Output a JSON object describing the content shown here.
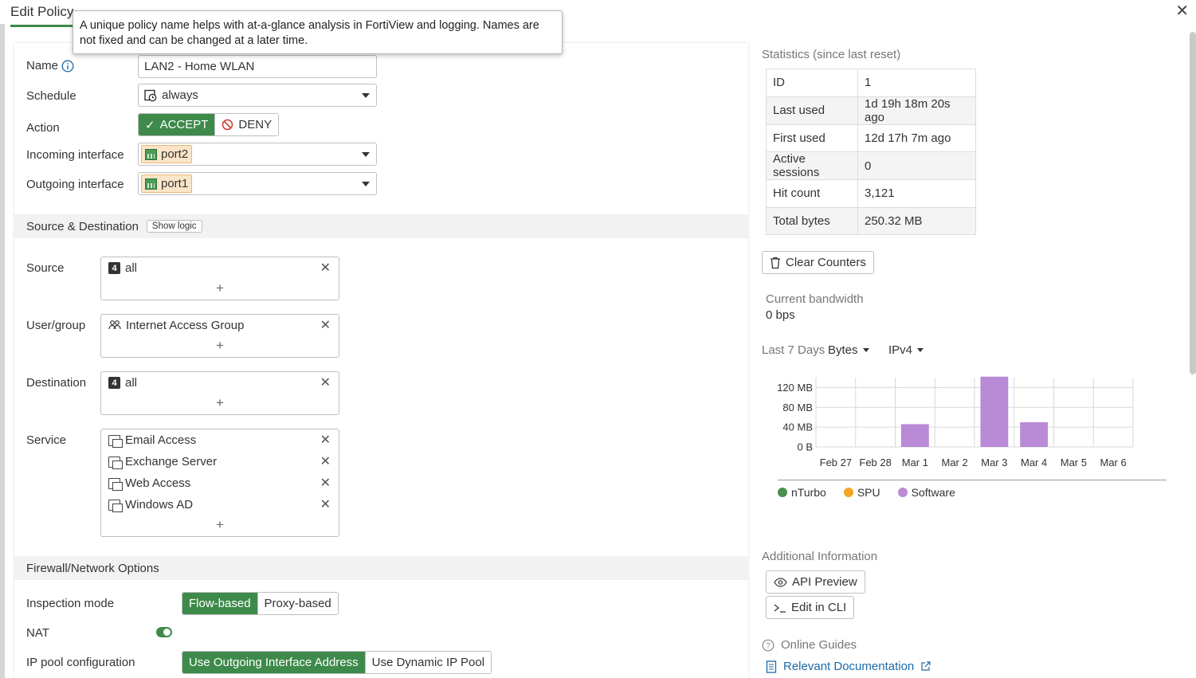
{
  "header": {
    "title": "Edit Policy"
  },
  "tooltip": {
    "text": "A unique policy name helps with at-a-glance analysis in FortiView and logging. Names are not fixed and can be changed at a later time."
  },
  "form": {
    "name_label": "Name",
    "name_value": "LAN2 - Home WLAN",
    "schedule_label": "Schedule",
    "schedule_value": "always",
    "action_label": "Action",
    "action_accept": "ACCEPT",
    "action_deny": "DENY",
    "incoming_label": "Incoming interface",
    "incoming_value": "port2",
    "outgoing_label": "Outgoing interface",
    "outgoing_value": "port1",
    "srcdst_section": "Source & Destination",
    "show_logic": "Show logic",
    "source_label": "Source",
    "source_items": [
      "all"
    ],
    "usergroup_label": "User/group",
    "usergroup_items": [
      "Internet Access Group"
    ],
    "destination_label": "Destination",
    "destination_items": [
      "all"
    ],
    "service_label": "Service",
    "service_items": [
      "Email Access",
      "Exchange Server",
      "Web Access",
      "Windows AD"
    ],
    "plus": "+",
    "remove": "✕",
    "firewall_section": "Firewall/Network Options",
    "inspection_label": "Inspection mode",
    "inspection_flow": "Flow-based",
    "inspection_proxy": "Proxy-based",
    "nat_label": "NAT",
    "nat_enabled": true,
    "ippool_label": "IP pool configuration",
    "ippool_outgoing": "Use Outgoing Interface Address",
    "ippool_dynamic": "Use Dynamic IP Pool"
  },
  "stats": {
    "title": "Statistics (since last reset)",
    "rows": [
      {
        "k": "ID",
        "v": "1"
      },
      {
        "k": "Last used",
        "v": "1d 19h 18m 20s ago"
      },
      {
        "k": "First used",
        "v": "12d 17h 7m ago"
      },
      {
        "k": "Active sessions",
        "v": "0"
      },
      {
        "k": "Hit count",
        "v": "3,121"
      },
      {
        "k": "Total bytes",
        "v": "250.32 MB"
      }
    ],
    "clear_counters": "Clear Counters",
    "bandwidth_label": "Current bandwidth",
    "bandwidth_value": "0 bps",
    "period_label": "Last 7 Days",
    "unit_select": "Bytes",
    "ip_select": "IPv4"
  },
  "chart_data": {
    "type": "bar",
    "categories": [
      "Feb 27",
      "Feb 28",
      "Mar 1",
      "Mar 2",
      "Mar 3",
      "Mar 4",
      "Mar 5",
      "Mar 6"
    ],
    "series": [
      {
        "name": "nTurbo",
        "color": "#4a8f4e",
        "values": [
          0,
          0,
          0,
          0,
          0,
          0,
          0,
          0
        ]
      },
      {
        "name": "SPU",
        "color": "#f5a623",
        "values": [
          0,
          0,
          0,
          0,
          0,
          0,
          0,
          0
        ]
      },
      {
        "name": "Software",
        "color": "#b98ad6",
        "values": [
          0,
          0,
          46,
          0,
          142,
          50,
          0,
          0
        ]
      }
    ],
    "yticks": [
      "0 B",
      "40 MB",
      "80 MB",
      "120 MB"
    ],
    "ylim": [
      0,
      140
    ],
    "ylabel": "",
    "xlabel": ""
  },
  "additional": {
    "title": "Additional Information",
    "api_preview": "API Preview",
    "edit_cli": "Edit in CLI",
    "guides": "Online Guides",
    "docs": "Relevant Documentation"
  }
}
